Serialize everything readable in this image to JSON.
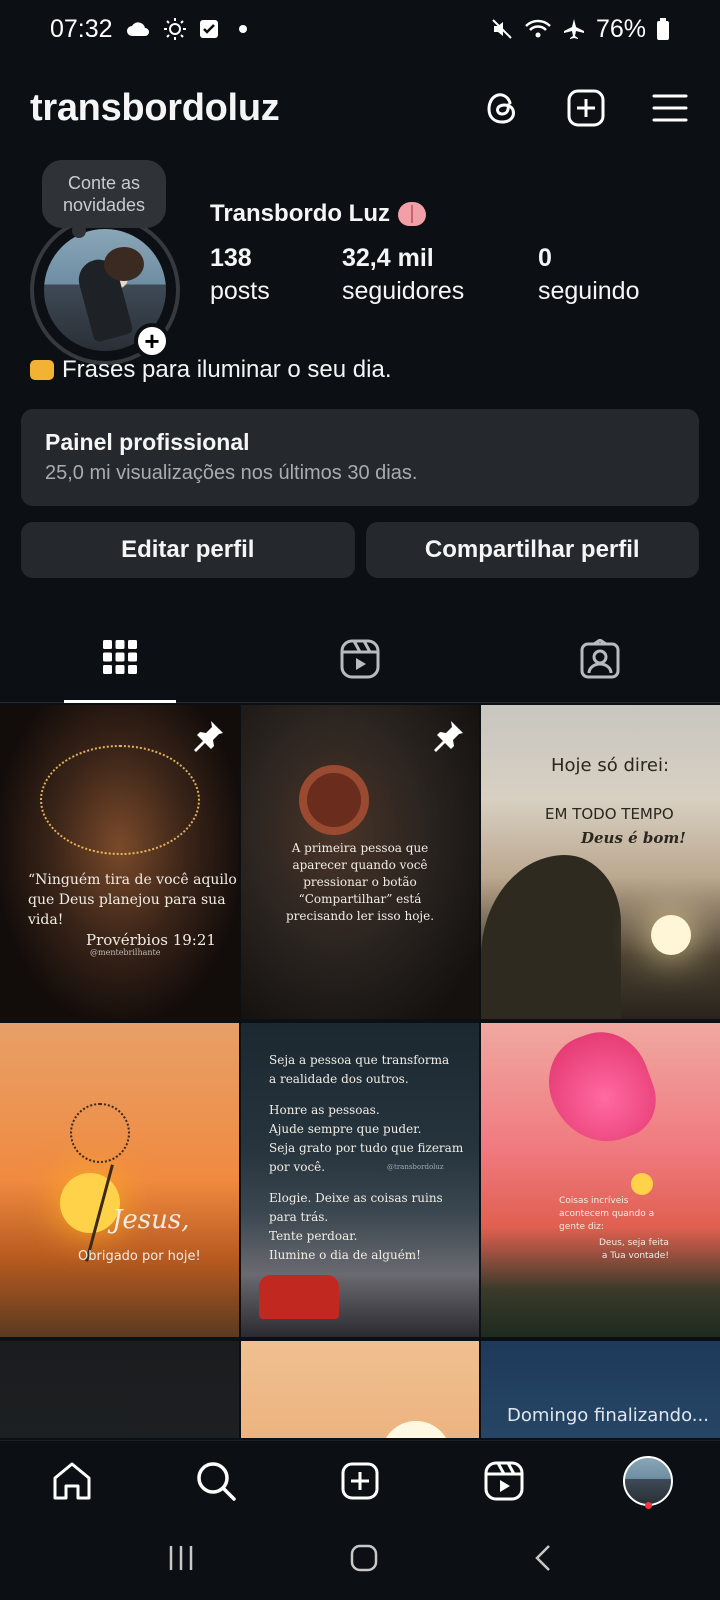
{
  "status_bar": {
    "time": "07:32",
    "battery": "76%"
  },
  "header": {
    "username": "transbordoluz"
  },
  "profile": {
    "note": "Conte as novidades",
    "display_name": "Transbordo Luz",
    "stats": [
      {
        "value": "138",
        "label": "posts"
      },
      {
        "value": "32,4 mil",
        "label": "seguidores"
      },
      {
        "value": "0",
        "label": "seguindo"
      }
    ],
    "bio": "Frases para iluminar o seu dia."
  },
  "panel": {
    "title": "Painel profissional",
    "subtitle": "25,0 mi visualizações nos últimos 30 dias."
  },
  "buttons": {
    "edit": "Editar perfil",
    "share": "Compartilhar perfil"
  },
  "posts": [
    {
      "lines": [
        "“Ninguém tira de você aquilo",
        "que Deus planejou para sua",
        "vida!"
      ],
      "ref": "Provérbios 19:21",
      "handle": "@mentebrilhante"
    },
    {
      "lines": [
        "A primeira pessoa que",
        "aparecer quando você",
        "pressionar o botão",
        "“Compartilhar” está",
        "precisando ler isso hoje."
      ]
    },
    {
      "heading": "Hoje só direi:",
      "line1": "EM TODO TEMPO",
      "line2": "Deus é bom!"
    },
    {
      "title": "Jesus,",
      "subtitle": "Obrigado por hoje!"
    },
    {
      "lines": [
        "Seja a pessoa que transforma",
        "a realidade dos outros.",
        "",
        "Honre as pessoas.",
        "Ajude sempre que puder.",
        "Seja grato por tudo que fizeram",
        "por você.",
        "",
        "Elogie. Deixe as coisas ruins",
        "para trás.",
        "Tente perdoar.",
        "Ilumine o dia de alguém!"
      ],
      "handle": "@transbordoluz"
    },
    {
      "lines": [
        "Coisas incríveis",
        "acontecem quando a",
        "gente diz:"
      ],
      "reply": [
        "Deus, seja feita",
        "a Tua vontade!"
      ]
    },
    {},
    {},
    {
      "text": "Domingo finalizando..."
    }
  ],
  "colors": {
    "background": "#0c1014",
    "panel": "#25292e",
    "notification_dot": "#ff3040"
  }
}
